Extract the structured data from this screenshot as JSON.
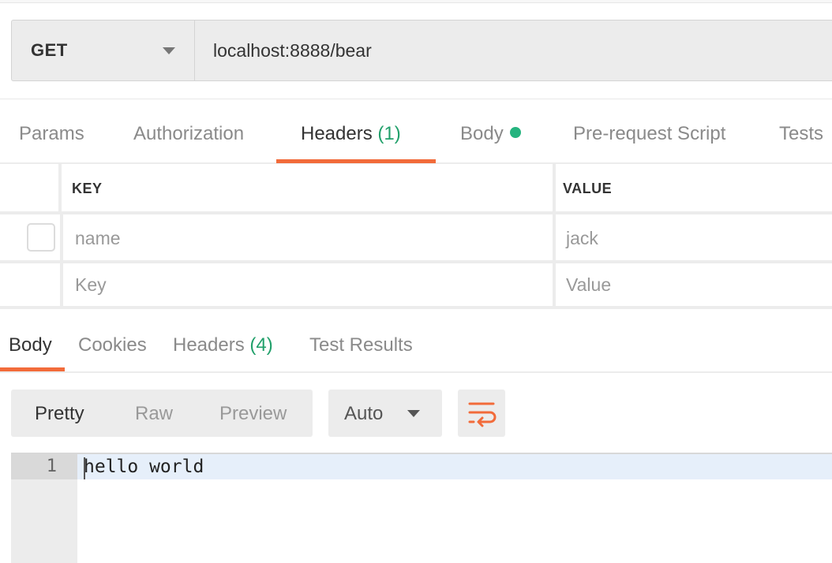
{
  "request": {
    "method": "GET",
    "url": "localhost:8888/bear"
  },
  "request_tabs": [
    {
      "label": "Params"
    },
    {
      "label": "Authorization"
    },
    {
      "label": "Headers",
      "count": "(1)",
      "active": true
    },
    {
      "label": "Body",
      "indicator": "dot"
    },
    {
      "label": "Pre-request Script"
    },
    {
      "label": "Tests"
    }
  ],
  "headers_table": {
    "columns": [
      "KEY",
      "VALUE"
    ],
    "rows": [
      {
        "key": "name",
        "value": "jack",
        "checked": false
      },
      {
        "key": "Key",
        "value": "Value",
        "placeholder": true
      }
    ]
  },
  "response_tabs": [
    {
      "label": "Body",
      "active": true
    },
    {
      "label": "Cookies"
    },
    {
      "label": "Headers",
      "count": "(4)"
    },
    {
      "label": "Test Results"
    }
  ],
  "response_view": {
    "modes": [
      "Pretty",
      "Raw",
      "Preview"
    ],
    "active_mode": "Pretty",
    "format": "Auto",
    "wrap_icon": "wrap-lines-icon"
  },
  "editor": {
    "lines": [
      {
        "number": "1",
        "text": "hello world"
      }
    ]
  },
  "colors": {
    "accent": "#f26b3a",
    "count_green": "#22a06b",
    "dot_green": "#26b47f",
    "highlight": "#e6effa"
  }
}
